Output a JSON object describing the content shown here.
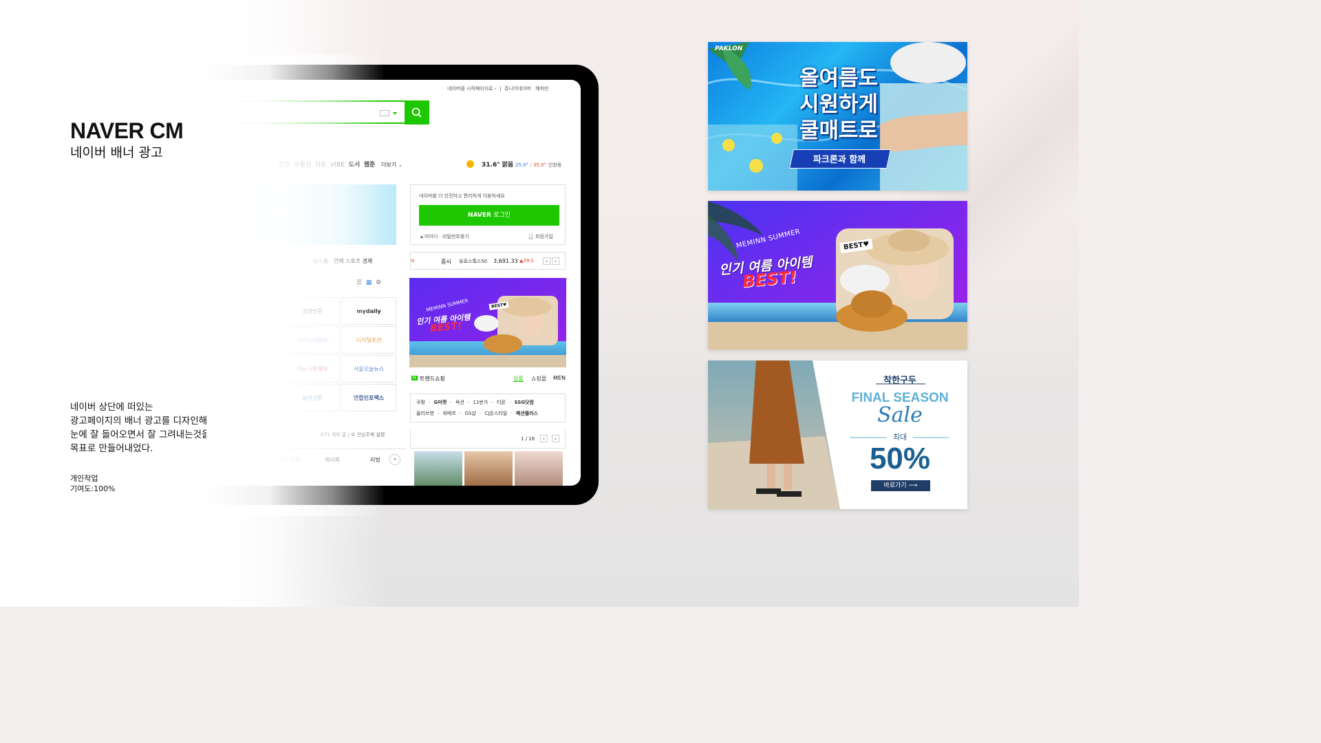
{
  "heading": {
    "title": "NAVER CM",
    "subtitle": "네이버 배너 광고"
  },
  "description": {
    "line1": "네이버 상단에 떠있는",
    "line2": "광고페이지의 배너 광고를 디자인해보았다.",
    "line3": "눈에 잘 들어오면서 잘 그려내는것을",
    "line4": "목표로 만들어내었다."
  },
  "meta": {
    "line1": "개인작업",
    "line2": "기여도:100%"
  },
  "tablet": {
    "topbar": {
      "start_page": "네이버를 시작페이지로",
      "junior": "쥬니어네이버",
      "happybean": "해피빈"
    },
    "nav": {
      "items": [
        "증권",
        "부동산",
        "지도",
        "VIBE",
        "도서",
        "웹툰"
      ],
      "more": "더보기"
    },
    "weather": {
      "temp": "31.6°",
      "condition": "맑음",
      "low": "25.0°",
      "high": "35.0°",
      "location": "인창동"
    },
    "login": {
      "prompt": "네이버를 더 안전하고 편리하게 이용하세요",
      "button_brand": "NAVER",
      "button_text": "로그인",
      "find": "아이디 · 비밀번호찾기",
      "signup": "회원가입"
    },
    "news_tabs": {
      "newsstand": "뉴스홈",
      "entertainment": "연예",
      "sports": "스포츠",
      "economy": "경제"
    },
    "stock": {
      "pct": "%",
      "label": "증시",
      "index": "유로스톡스50",
      "value": "3,691.33",
      "change": "▲39.1"
    },
    "press": [
      [
        "경향신문",
        "mydaily"
      ],
      [
        "아이뉴데일리",
        "디지털조선"
      ],
      [
        "이뉴스투데이",
        "서울오늘뉴스"
      ],
      [
        "농민신문",
        "연합인포맥스"
      ]
    ],
    "subscribe": {
      "count": "671 개의 글",
      "setting": "관심주제 설정"
    },
    "bottom_tabs": [
      "추천·구독",
      "레시피",
      "리빙"
    ],
    "trend": {
      "title": "트렌드쇼핑",
      "tabs": [
        "상품",
        "쇼핑몰",
        "MEN"
      ]
    },
    "shops_row1": [
      "쿠팡",
      "G마켓",
      "옥션",
      "11번가",
      "티몬",
      "SSG닷컴"
    ],
    "shops_row2": [
      "올리브영",
      "위메프",
      "GS샵",
      "CJ온스타일",
      "패션플러스"
    ],
    "pager": "1 / 18"
  },
  "banners": {
    "b1": {
      "logo": "PAKLON",
      "lines": [
        "올여름도",
        "시원하게",
        "쿨매트로"
      ],
      "tagline": "파크론과 함께"
    },
    "b2": {
      "sub": "MEMINN SUMMER",
      "title": "인기 여름 아이템",
      "emph": "BEST!",
      "badge": "BEST♥"
    },
    "b3": {
      "brand": "착한구두",
      "final": "FINAL SEASON",
      "sale": "Sale",
      "max": "최대",
      "pct": "50%",
      "cta": "바로가기 ⟶"
    }
  },
  "colors": {
    "naver_green": "#1ec800",
    "banner2_purple": "#7b26f0",
    "banner3_navy": "#1f3d66"
  }
}
